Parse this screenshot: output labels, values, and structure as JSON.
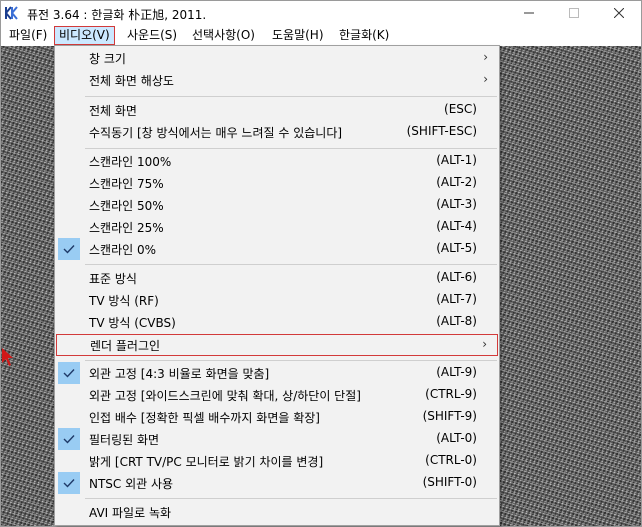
{
  "window": {
    "title": "퓨전 3.64 : 한글화 朴正旭, 2011.",
    "controls": {
      "minimize": "—",
      "maximize": "☐",
      "close": "✕"
    }
  },
  "menubar": {
    "items": [
      {
        "label": "파일(F)"
      },
      {
        "label": "비디오(V)"
      },
      {
        "label": "사운드(S)"
      },
      {
        "label": "선택사항(O)"
      },
      {
        "label": "도움말(H)"
      },
      {
        "label": "한글화(K)"
      }
    ]
  },
  "video_menu": {
    "items": [
      {
        "label": "창 크기",
        "shortcut": "",
        "submenu": true,
        "checked": false
      },
      {
        "label": "전체 화면 해상도",
        "shortcut": "",
        "submenu": true,
        "checked": false
      },
      {
        "label": "전체 화면",
        "shortcut": "(ESC)",
        "submenu": false,
        "checked": false
      },
      {
        "label": "수직동기 [창 방식에서는 매우 느려질 수 있습니다]",
        "shortcut": "(SHIFT-ESC)",
        "submenu": false,
        "checked": false
      },
      {
        "label": "스캔라인 100%",
        "shortcut": "(ALT-1)",
        "submenu": false,
        "checked": false
      },
      {
        "label": "스캔라인 75%",
        "shortcut": "(ALT-2)",
        "submenu": false,
        "checked": false
      },
      {
        "label": "스캔라인 50%",
        "shortcut": "(ALT-3)",
        "submenu": false,
        "checked": false
      },
      {
        "label": "스캔라인 25%",
        "shortcut": "(ALT-4)",
        "submenu": false,
        "checked": false
      },
      {
        "label": "스캔라인 0%",
        "shortcut": "(ALT-5)",
        "submenu": false,
        "checked": true
      },
      {
        "label": "표준 방식",
        "shortcut": "(ALT-6)",
        "submenu": false,
        "checked": false
      },
      {
        "label": "TV 방식 (RF)",
        "shortcut": "(ALT-7)",
        "submenu": false,
        "checked": false
      },
      {
        "label": "TV 방식 (CVBS)",
        "shortcut": "(ALT-8)",
        "submenu": false,
        "checked": false
      },
      {
        "label": "렌더 플러그인",
        "shortcut": "",
        "submenu": true,
        "checked": false
      },
      {
        "label": "외관 고정 [4:3 비율로 화면을 맞춤]",
        "shortcut": "(ALT-9)",
        "submenu": false,
        "checked": true
      },
      {
        "label": "외관 고정 [와이드스크린에 맞춰 확대, 상/하단이 단절]",
        "shortcut": "(CTRL-9)",
        "submenu": false,
        "checked": false
      },
      {
        "label": "인접 배수 [정확한 픽셀 배수까지 화면을 확장]",
        "shortcut": "(SHIFT-9)",
        "submenu": false,
        "checked": false
      },
      {
        "label": "필터링된 화면",
        "shortcut": "(ALT-0)",
        "submenu": false,
        "checked": true
      },
      {
        "label": "밝게 [CRT TV/PC 모니터로 밝기 차이를 변경]",
        "shortcut": "(CTRL-0)",
        "submenu": false,
        "checked": false
      },
      {
        "label": "NTSC 외관 사용",
        "shortcut": "(SHIFT-0)",
        "submenu": false,
        "checked": true
      },
      {
        "label": "AVI 파일로 녹화",
        "shortcut": "",
        "submenu": false,
        "checked": false
      }
    ]
  },
  "colors": {
    "menu_active_bg": "#cce8ff",
    "highlight_border": "#d23a3a",
    "check_bg": "#99ccf3",
    "menu_bg": "#f2f2f2"
  },
  "icons": {
    "check": "check-icon",
    "submenu": "chevron-right-icon",
    "app": "app-icon"
  }
}
